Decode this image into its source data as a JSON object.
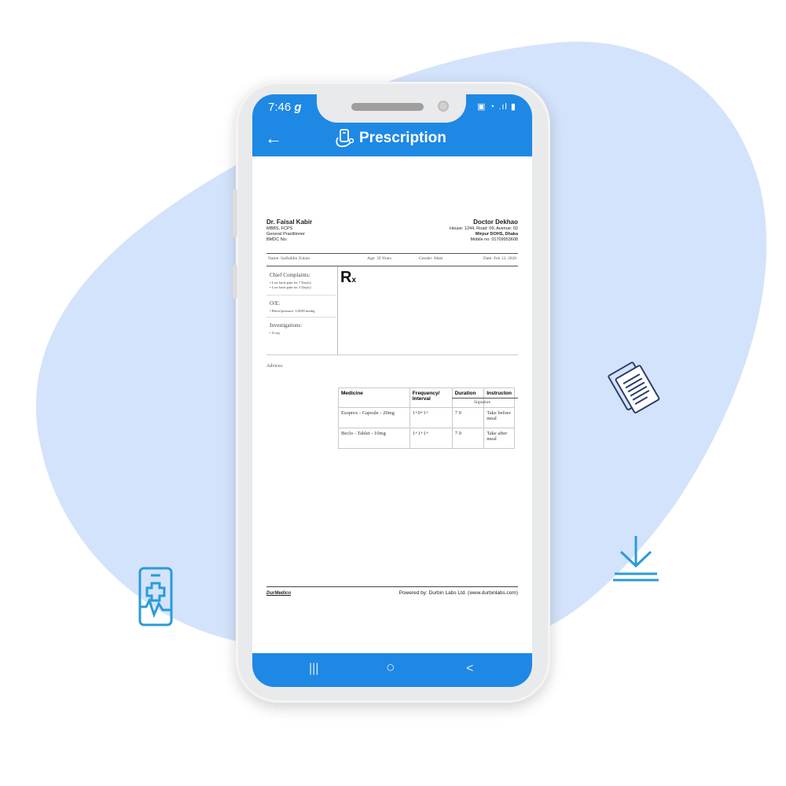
{
  "status_bar": {
    "time": "7:46",
    "carrier_glyph": "g",
    "icons": "▣ ◔ .ıl ▮"
  },
  "app_bar": {
    "back_icon": "arrow-left-icon",
    "title": "Prescription",
    "title_icon": "prescription-icon"
  },
  "doctor": {
    "name": "Dr. Faisal Kabir",
    "degrees": "MBBS, FCPS",
    "role": "General Practitioner",
    "bmdc": "BMDC No:"
  },
  "clinic": {
    "name": "Doctor Dekhao",
    "address1": "House: 1244, Road: 09, Avenue: 02",
    "address2": "Mirpur DOHS, Dhaka",
    "mobile": "Mobile no: 01709953608"
  },
  "patient": {
    "name": "Name: Saifuddin Zubair",
    "age": "Age: 39 Years",
    "gender": "Gender: Male",
    "date": "Date: Feb 13, 2020"
  },
  "sections": {
    "chief_complaints_title": "Chief Complaints:",
    "chief_complaints": [
      "Low back pain for 7 Day(s)",
      "Low back pain for 3 Day(s)"
    ],
    "oe_title": "O/E:",
    "oe_items": [
      "Blood pressure: 120/80 mmhg"
    ],
    "investigations_title": "Investigations:",
    "investigations": [
      "X-ray"
    ]
  },
  "rx_symbol": "R",
  "rx_sub": "x",
  "medicine_table": {
    "headers": [
      "Medicine",
      "Frequency/ Interval",
      "Duration",
      "Instructon"
    ],
    "rows": [
      [
        "Esoprex - Capsule - 20mg",
        "1+0+1+",
        "7 0",
        "Take before meal"
      ],
      [
        "Beclo - Tablet - 10mg",
        "1+1+1+",
        "7 0",
        "Take after meal"
      ]
    ]
  },
  "advices_label": "Advices:",
  "signature_label": "Signature",
  "footer": {
    "brand": "DurMedico",
    "powered_by": "Powered by: Durbin Labs Ltd. (www.durbinlabs.com)"
  },
  "nav": {
    "recents": "|||",
    "home": "○",
    "back": "<"
  },
  "colors": {
    "primary": "#1e88e5",
    "blob": "#d3e3fb",
    "icon_blue": "#2a9bd8",
    "icon_navy": "#2c3e6b"
  }
}
